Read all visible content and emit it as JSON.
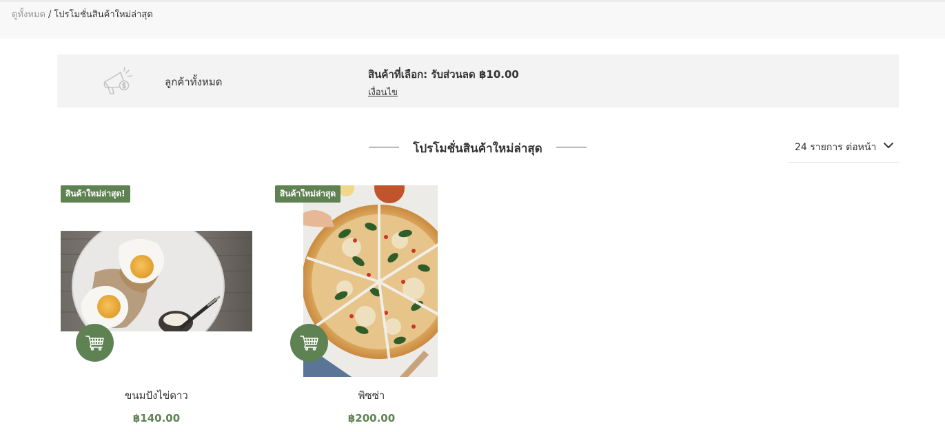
{
  "breadcrumb": {
    "home_label": "ดูทั้งหมด",
    "separator": "/",
    "current_label": "โปรโมชั่นสินค้าใหม่ล่าสุด"
  },
  "promo_banner": {
    "icon": "megaphone-dollar-icon",
    "audience": "ลูกค้าทั้งหมด",
    "title": "สินค้าที่เลือก: รับส่วนลด ฿10.00",
    "terms_label": "เงื่อนไข"
  },
  "section": {
    "title": "โปรโมชั่นสินค้าใหม่ล่าสุด"
  },
  "per_page": {
    "label": "24 รายการ ต่อหน้า",
    "icon": "chevron-down-icon"
  },
  "products": [
    {
      "badge": "สินค้าใหม่ล่าสุด!",
      "name": "ขนมปังไข่ดาว",
      "price": "฿140.00",
      "cart_icon": "shopping-cart-icon"
    },
    {
      "badge": "สินค้าใหม่ล่าสุด",
      "name": "พิซซ่า",
      "price": "฿200.00",
      "cart_icon": "shopping-cart-icon"
    }
  ],
  "colors": {
    "accent": "#5f8252",
    "banner_bg": "#f3f3f3",
    "breadcrumb_bg": "#f8f8f8",
    "text": "#333333"
  }
}
